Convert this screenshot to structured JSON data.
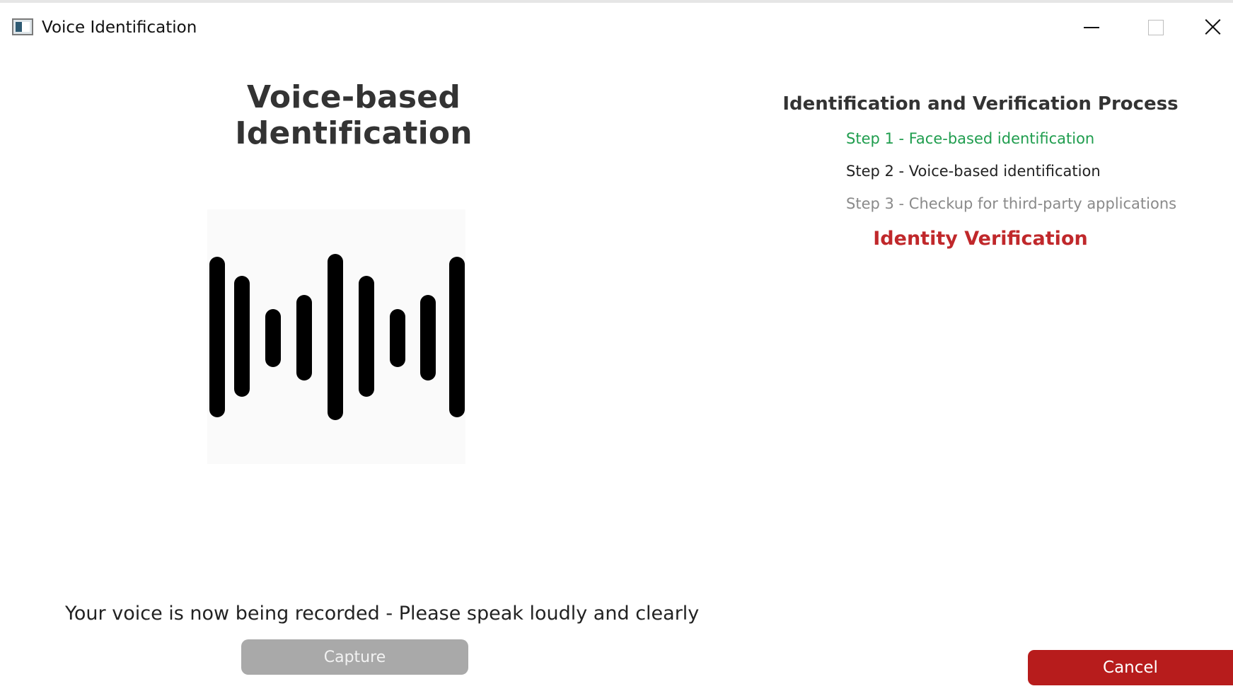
{
  "window": {
    "title": "Voice Identification",
    "icon": "app-window-icon",
    "controls": [
      "minimize-icon",
      "maximize-icon",
      "close-icon"
    ]
  },
  "voice_panel": {
    "title": "Voice-based Identification",
    "waveform_icon": "sound-wave-icon",
    "status": "Your voice is now being recorded - Please speak loudly and clearly",
    "capture_label": "Capture",
    "capture_enabled": false
  },
  "process_panel": {
    "title": "Identification and Verification Process",
    "steps": [
      {
        "label": "Step 1 - Face-based identification",
        "state": "completed"
      },
      {
        "label": "Step 2 - Voice-based identification",
        "state": "current"
      },
      {
        "label": "Step 3 - Checkup for third-party applications",
        "state": "pending"
      }
    ],
    "verification_label": "Identity Verification"
  },
  "footer": {
    "cancel_label": "Cancel"
  },
  "colors": {
    "completed": "#1f9d4e",
    "current": "#222222",
    "pending": "#8a8a8a",
    "accent_red": "#c0282b",
    "cancel_bg": "#b71c1c",
    "capture_disabled_bg": "#a9a9a9"
  }
}
